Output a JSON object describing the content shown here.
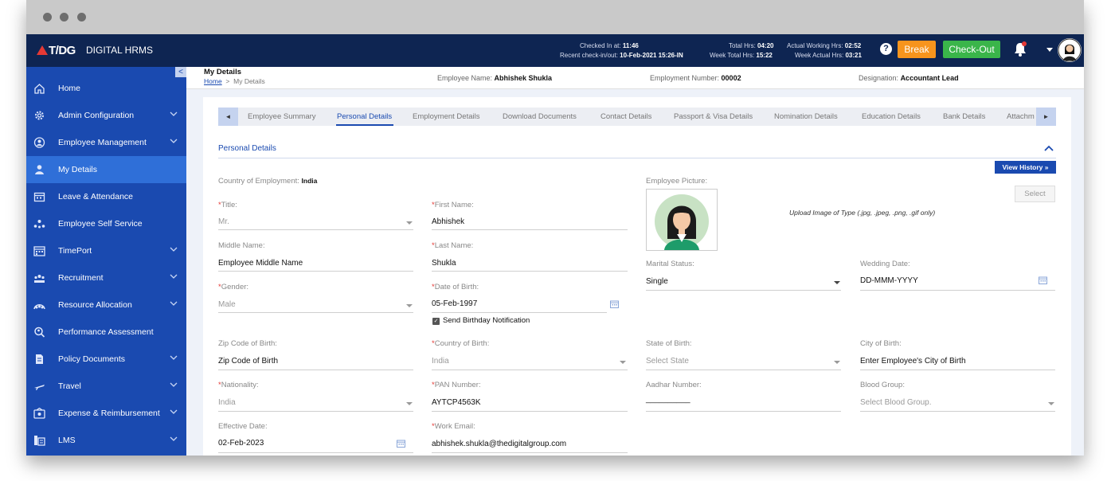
{
  "brand": {
    "logo": "T/DG",
    "name": "DIGITAL HRMS"
  },
  "header": {
    "checked_in_label": "Checked In at:",
    "checked_in_value": "11:46",
    "recent_label": "Recent check-in/out:",
    "recent_value": "10-Feb-2021 15:26-IN",
    "total_hrs_label": "Total Hrs:",
    "total_hrs_value": "04:20",
    "week_total_label": "Week Total Hrs:",
    "week_total_value": "15:22",
    "actual_hrs_label": "Actual Working Hrs:",
    "actual_hrs_value": "02:52",
    "week_actual_label": "Week Actual Hrs:",
    "week_actual_value": "03:21",
    "help": "?",
    "break_label": "Break",
    "checkout_label": "Check-Out",
    "colors": {
      "topbar": "#0e2552",
      "break": "#f7941d",
      "checkout": "#3ab54a"
    }
  },
  "sidebar": {
    "collapse_icon": "<",
    "items": [
      {
        "label": "Home",
        "icon": "home-icon",
        "chevron": false
      },
      {
        "label": "Admin Configuration",
        "icon": "gear-icon",
        "chevron": true
      },
      {
        "label": "Employee Management",
        "icon": "user-circle-icon",
        "chevron": true
      },
      {
        "label": "My Details",
        "icon": "person-icon",
        "chevron": false,
        "active": true
      },
      {
        "label": "Leave & Attendance",
        "icon": "calendar-icon",
        "chevron": false
      },
      {
        "label": "Employee Self Service",
        "icon": "network-icon",
        "chevron": false
      },
      {
        "label": "TimePort",
        "icon": "calendar-grid-icon",
        "chevron": true
      },
      {
        "label": "Recruitment",
        "icon": "group-icon",
        "chevron": true
      },
      {
        "label": "Resource Allocation",
        "icon": "resource-icon",
        "chevron": true
      },
      {
        "label": "Performance Assessment",
        "icon": "performance-icon",
        "chevron": false
      },
      {
        "label": "Policy Documents",
        "icon": "document-icon",
        "chevron": true
      },
      {
        "label": "Travel",
        "icon": "plane-icon",
        "chevron": true
      },
      {
        "label": "Expense & Reimbursement",
        "icon": "wallet-icon",
        "chevron": true
      },
      {
        "label": "LMS",
        "icon": "lms-icon",
        "chevron": true
      }
    ]
  },
  "subheader": {
    "title": "My Details",
    "crumb_home": "Home",
    "crumb_sep": ">",
    "crumb_current": "My Details",
    "emp_name_label": "Employee Name:",
    "emp_name": "Abhishek Shukla",
    "emp_num_label": "Employment Number:",
    "emp_num": "00002",
    "designation_label": "Designation:",
    "designation": "Accountant Lead"
  },
  "tabs": {
    "prev": "◄",
    "next": "►",
    "items": [
      "Employee Summary",
      "Personal Details",
      "Employment Details",
      "Download Documents",
      "Contact Details",
      "Passport & Visa Details",
      "Nomination Details",
      "Education Details",
      "Bank Details",
      "Attachm"
    ],
    "active": "Personal Details"
  },
  "section": {
    "title": "Personal Details",
    "view_history": "View History »"
  },
  "form": {
    "country_of_employment_label": "Country of Employment:",
    "country_of_employment": "India",
    "employee_picture_label": "Employee Picture:",
    "upload_note": "Upload Image of Type (.jpg, .jpeg, .png, .gif only)",
    "select_button": "Select",
    "title_label": "Title:",
    "title": "Mr.",
    "first_name_label": "First Name:",
    "first_name": "Abhishek",
    "middle_name_label": "Middle Name:",
    "middle_name": "Employee Middle Name",
    "last_name_label": "Last Name:",
    "last_name": "Shukla",
    "marital_status_label": "Marital Status:",
    "marital_status": "Single",
    "wedding_date_label": "Wedding Date:",
    "wedding_date": "DD-MMM-YYYY",
    "gender_label": "Gender:",
    "gender": "Male",
    "dob_label": "Date of Birth:",
    "dob": "05-Feb-1997",
    "birthday_notification": "Send Birthday Notification",
    "zip_label": "Zip Code of Birth:",
    "zip": "Zip Code of Birth",
    "country_birth_label": "Country of Birth:",
    "country_birth": "India",
    "state_birth_label": "State of Birth:",
    "state_birth": "Select State",
    "city_birth_label": "City of Birth:",
    "city_birth": "Enter Employee's City of Birth",
    "nationality_label": "Nationality:",
    "nationality": "India",
    "pan_label": "PAN Number:",
    "pan": "AYTCP4563K",
    "aadhar_label": "Aadhar Number:",
    "aadhar": "__________",
    "blood_label": "Blood Group:",
    "blood": "Select Blood Group.",
    "effective_label": "Effective Date:",
    "effective": "02-Feb-2023",
    "work_email_label": "Work Email:",
    "work_email": "abhishek.shukla@thedigitalgroup.com"
  }
}
